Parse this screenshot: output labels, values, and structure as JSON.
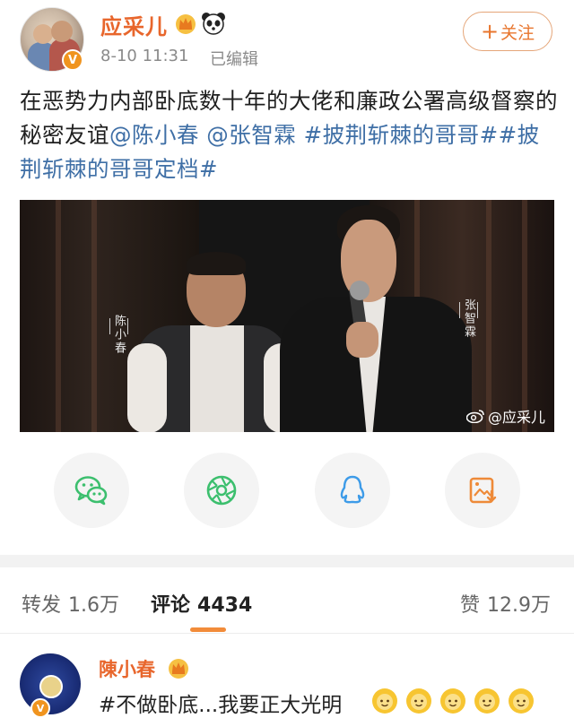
{
  "post": {
    "username": "应采儿",
    "time": "8-10 11:31",
    "edited": "已编辑",
    "follow_label": "关注",
    "text_plain": "在恶势力内部卧底数十年的大佬和廉政公署高级督察的秘密友谊",
    "mentions": [
      "@陈小春",
      "@张智霖"
    ],
    "hashtags": [
      "#披荆斩棘的哥哥#",
      "#披荆斩棘的哥哥定档#"
    ],
    "verified_badge": "V"
  },
  "media": {
    "name_left": "陈小春",
    "name_right": "张智霖",
    "watermark": "@应采儿"
  },
  "share": {
    "buttons": [
      "wechat-icon",
      "moments-icon",
      "qq-icon",
      "save-image-icon"
    ],
    "colors": {
      "accent": "#3cbf6e",
      "qq": "#3d9be8",
      "save": "#ee8a38"
    }
  },
  "tabs": {
    "repost_label": "转发",
    "repost_count": "1.6万",
    "comment_label": "评论",
    "comment_count": "4434",
    "like_label": "赞",
    "like_count": "12.9万",
    "active": "comment"
  },
  "comment": {
    "name": "陳小春",
    "text": "#不做卧底...我要正大光明",
    "emoji_count": 5
  },
  "colors": {
    "username": "#e8662c",
    "link": "#3f6fa6",
    "tab_indicator": "#f28c3a"
  }
}
